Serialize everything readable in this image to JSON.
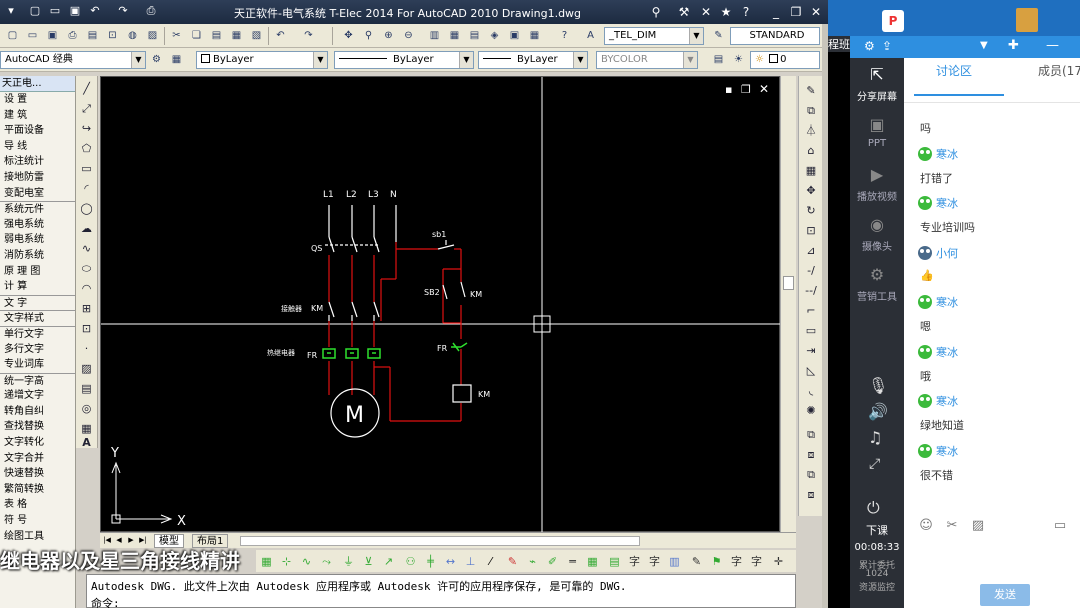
{
  "titlebar": {
    "title": "天正软件-电气系统 T-Elec 2014   For AutoCAD 2010     Drawing1.dwg"
  },
  "toolbar": {
    "workspace": "AutoCAD 经典",
    "layer": "ByLayer",
    "linetype": "ByLayer",
    "lineweight": "ByLayer",
    "color": "BYCOLOR",
    "dimstyle": "_TEL_DIM",
    "textstyle": "STANDARD",
    "layer_num": "0"
  },
  "leftmenu": {
    "header": "天正电...",
    "items": [
      {
        "label": "设  置",
        "spread": true
      },
      {
        "label": "建  筑",
        "spread": true
      },
      {
        "label": "平面设备"
      },
      {
        "label": "导  线",
        "spread": true
      },
      {
        "label": "标注统计"
      },
      {
        "label": "接地防雷"
      },
      {
        "label": "变配电室"
      },
      {
        "label": "系统元件"
      },
      {
        "label": "强电系统"
      },
      {
        "label": "弱电系统"
      },
      {
        "label": "消防系统"
      },
      {
        "label": "原 理 图"
      },
      {
        "label": "计  算",
        "spread": true
      },
      {
        "label": "文  字",
        "spread": true
      },
      {
        "label": "文字样式"
      },
      {
        "label": "单行文字"
      },
      {
        "label": "多行文字"
      },
      {
        "label": "专业词库"
      },
      {
        "label": "统一字高"
      },
      {
        "label": "递增文字"
      },
      {
        "label": "转角自纠"
      },
      {
        "label": "查找替换"
      },
      {
        "label": "文字转化"
      },
      {
        "label": "文字合并"
      },
      {
        "label": "快速替换"
      },
      {
        "label": "繁简转换"
      },
      {
        "label": "表  格",
        "spread": true
      },
      {
        "label": "符  号",
        "spread": true
      },
      {
        "label": "绘图工具"
      }
    ]
  },
  "drawing": {
    "phase_labels": [
      "L1",
      "L2",
      "L3",
      "N"
    ],
    "qs": "QS",
    "km_contactor": "接触器",
    "km": "KM",
    "fr_relay": "热继电器",
    "fr": "FR",
    "motor": "M",
    "sb1": "sb1",
    "sb2": "SB2",
    "km2": "KM",
    "fr2": "FR",
    "km_coil": "KM",
    "axis_x": "X",
    "axis_y": "Y"
  },
  "tabs": {
    "model": "模型",
    "layout1": "布局1"
  },
  "caption": "继电器以及星三角接线精讲",
  "cmdline": {
    "line1": "Autodesk DWG.  此文件上次由 Autodesk 应用程序或 Autodesk 许可的应用程序保存, 是可靠的 DWG.",
    "line2": "命令:"
  },
  "panel": {
    "left_items": [
      {
        "label": "分享屏幕",
        "icon": "share-screen-icon",
        "active": true
      },
      {
        "label": "PPT",
        "icon": "ppt-icon"
      },
      {
        "label": "播放视频",
        "icon": "play-video-icon"
      },
      {
        "label": "摄像头",
        "icon": "camera-icon"
      },
      {
        "label": "营销工具",
        "icon": "marketing-tool-icon"
      }
    ],
    "end_class": "下课",
    "timer": "00:08:33",
    "stats_line1": "累计委托",
    "stats_line2": "1024",
    "stats_line3": "资源监控",
    "tab_discuss": "讨论区",
    "tab_members": "成员(17",
    "send": "发送",
    "side_label": "程班",
    "messages": [
      {
        "user": "寒冰",
        "text": "吗"
      },
      {
        "user": "寒冰",
        "text": "打错了"
      },
      {
        "user": "寒冰",
        "text": "专业培训吗"
      },
      {
        "user": "小何",
        "text": "👍"
      },
      {
        "user": "寒冰",
        "text": "嗯"
      },
      {
        "user": "寒冰",
        "text": "哦"
      },
      {
        "user": "寒冰",
        "text": "绿地知道"
      },
      {
        "user": "寒冰",
        "text": "很不错"
      }
    ]
  }
}
